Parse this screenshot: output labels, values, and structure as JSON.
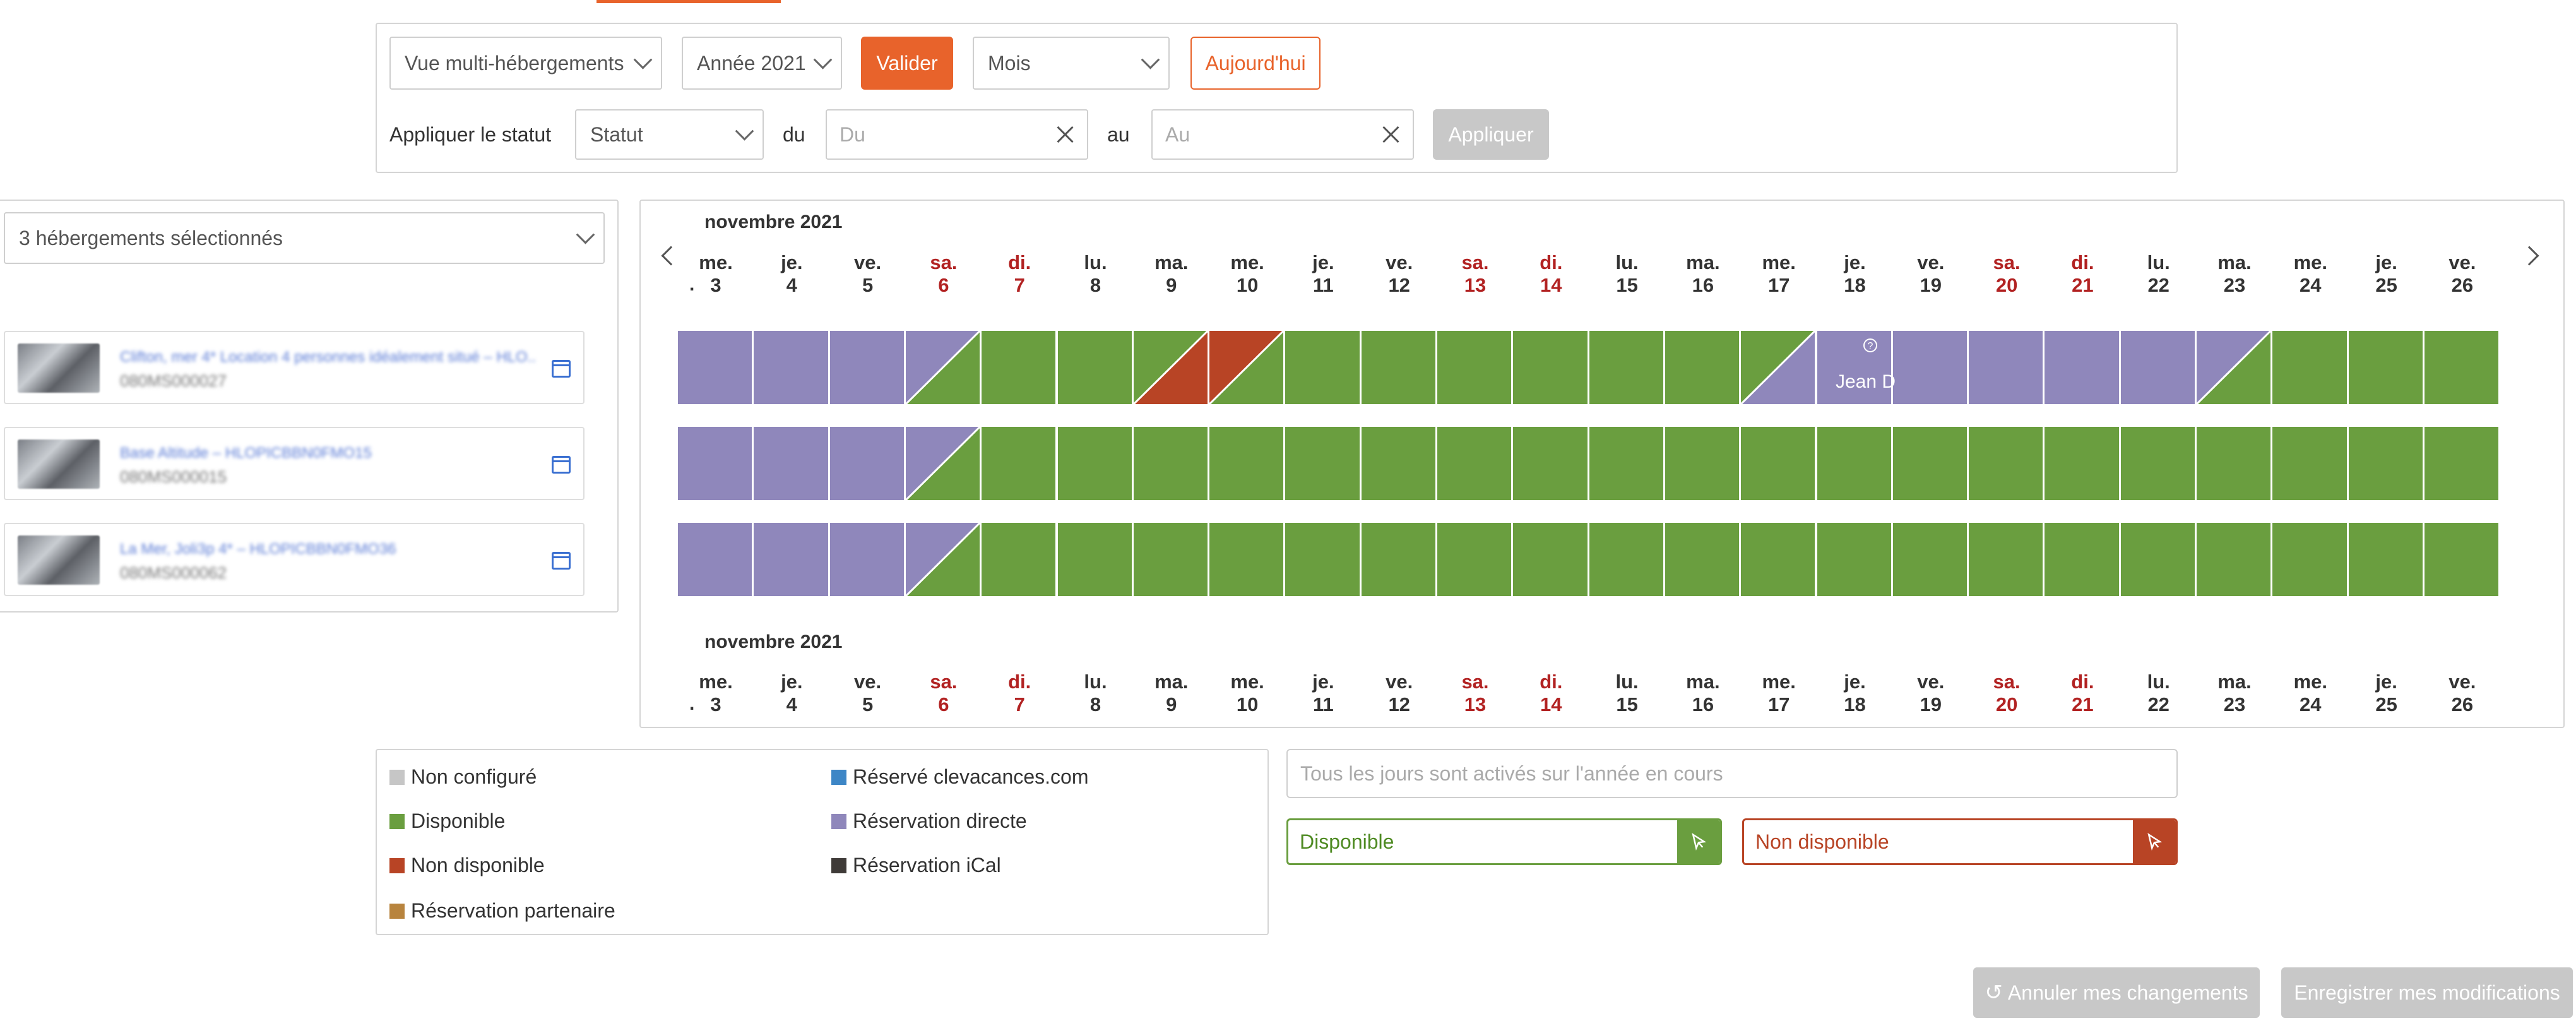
{
  "toolbar": {
    "view_select": "Vue multi-hébergements",
    "year_select": "Année 2021",
    "validate_label": "Valider",
    "period_select": "Mois",
    "today_label": "Aujourd'hui",
    "apply_status_label": "Appliquer le statut",
    "status_select": "Statut",
    "from_label": "du",
    "from_placeholder": "Du",
    "to_label": "au",
    "to_placeholder": "Au",
    "apply_label": "Appliquer"
  },
  "lodgings": {
    "selector": "3 hébergements sélectionnés",
    "items": [
      {
        "name": "Clifton, mer 4* Location 4 personnes idéalement situé – HLO...",
        "code": "080MS000027"
      },
      {
        "name": "Base Altitude – HLOPICBBN0FMO15",
        "code": "080MS000015"
      },
      {
        "name": "La Mer, Joli3p 4* – HLOPICBBN0FMO36",
        "code": "080MS000062"
      }
    ]
  },
  "calendar": {
    "month_label": "novembre 2021",
    "leading_dot": ".",
    "days": [
      {
        "name": "me.",
        "num": "3",
        "weekend": false
      },
      {
        "name": "je.",
        "num": "4",
        "weekend": false
      },
      {
        "name": "ve.",
        "num": "5",
        "weekend": false
      },
      {
        "name": "sa.",
        "num": "6",
        "weekend": true
      },
      {
        "name": "di.",
        "num": "7",
        "weekend": true
      },
      {
        "name": "lu.",
        "num": "8",
        "weekend": false
      },
      {
        "name": "ma.",
        "num": "9",
        "weekend": false
      },
      {
        "name": "me.",
        "num": "10",
        "weekend": false
      },
      {
        "name": "je.",
        "num": "11",
        "weekend": false
      },
      {
        "name": "ve.",
        "num": "12",
        "weekend": false
      },
      {
        "name": "sa.",
        "num": "13",
        "weekend": true
      },
      {
        "name": "di.",
        "num": "14",
        "weekend": true
      },
      {
        "name": "lu.",
        "num": "15",
        "weekend": false
      },
      {
        "name": "ma.",
        "num": "16",
        "weekend": false
      },
      {
        "name": "me.",
        "num": "17",
        "weekend": false
      },
      {
        "name": "je.",
        "num": "18",
        "weekend": false
      },
      {
        "name": "ve.",
        "num": "19",
        "weekend": false
      },
      {
        "name": "sa.",
        "num": "20",
        "weekend": true
      },
      {
        "name": "di.",
        "num": "21",
        "weekend": true
      },
      {
        "name": "lu.",
        "num": "22",
        "weekend": false
      },
      {
        "name": "ma.",
        "num": "23",
        "weekend": false
      },
      {
        "name": "me.",
        "num": "24",
        "weekend": false
      },
      {
        "name": "je.",
        "num": "25",
        "weekend": false
      },
      {
        "name": "ve.",
        "num": "26",
        "weekend": false
      }
    ],
    "rows": [
      [
        "R",
        "R",
        "R",
        "R",
        "R/D",
        "D",
        "D",
        "D/N",
        "N/D",
        "D",
        "D",
        "D",
        "D",
        "D",
        "D",
        "D/R",
        "R",
        "R",
        "R",
        "R",
        "R",
        "R/D",
        "D",
        "D",
        "D"
      ],
      [
        "R",
        "R",
        "R",
        "R",
        "R/D",
        "D",
        "D",
        "D",
        "D",
        "D",
        "D",
        "D",
        "D",
        "D",
        "D",
        "D",
        "D",
        "D",
        "D",
        "D",
        "D",
        "D",
        "D",
        "D",
        "D"
      ],
      [
        "R",
        "R",
        "R",
        "R",
        "R/D",
        "D",
        "D",
        "D",
        "D",
        "D",
        "D",
        "D",
        "D",
        "D",
        "D",
        "D",
        "D",
        "D",
        "D",
        "D",
        "D",
        "D",
        "D",
        "D",
        "D"
      ]
    ],
    "reservation_label": "Jean D",
    "reservation_info_icon": "?",
    "status_colors": {
      "D": "#6a9e3f",
      "R": "#8f87bb",
      "N": "#b84425",
      "G": "#c6c6c6"
    }
  },
  "legend": {
    "items": [
      {
        "label": "Non configuré",
        "color": "#c6c6c6"
      },
      {
        "label": "Réservé clevacances.com",
        "color": "#3d86c6"
      },
      {
        "label": "Disponible",
        "color": "#6a9e3f"
      },
      {
        "label": "Réservation directe",
        "color": "#8f87bb"
      },
      {
        "label": "Non disponible",
        "color": "#b84425"
      },
      {
        "label": "Réservation iCal",
        "color": "#3f3b38"
      },
      {
        "label": "Réservation partenaire",
        "color": "#b8843e"
      }
    ]
  },
  "side": {
    "note_placeholder": "Tous les jours sont activés sur l'année en cours",
    "available_label": "Disponible",
    "unavailable_label": "Non disponible"
  },
  "footer": {
    "cancel_label": "Annuler mes changements",
    "save_label": "Enregistrer mes modifications"
  }
}
